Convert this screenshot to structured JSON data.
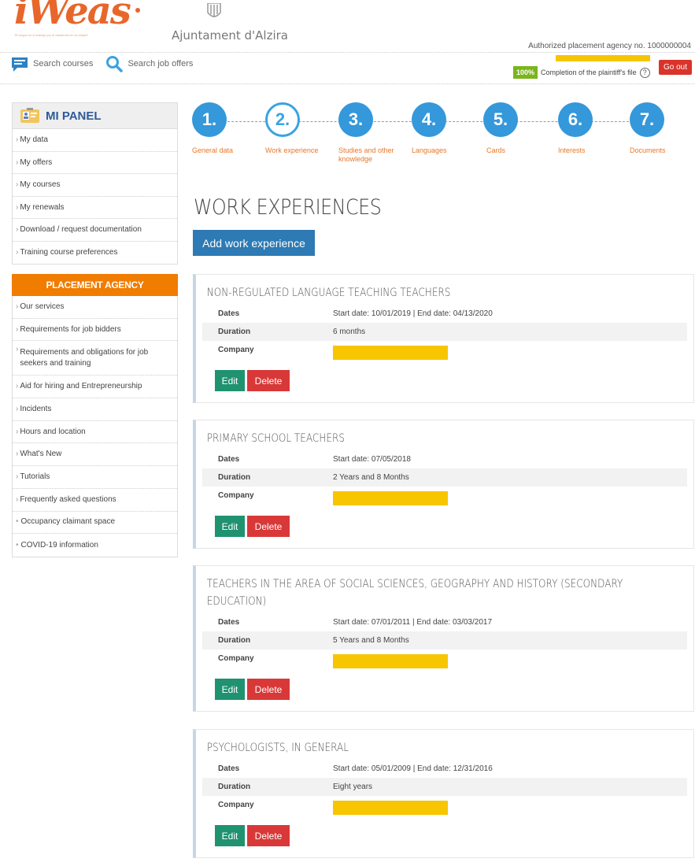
{
  "header": {
    "logo": "iWeas",
    "tagline": "\"El seguir en el trabajo por el desarrollo en la ciudad\"",
    "city": "Ajuntament d'Alzira",
    "agency_no": "Authorized placement agency no. 1000000004",
    "search_courses": "Search courses",
    "search_jobs": "Search job offers",
    "completion_pct": "100%",
    "completion_text": "Completion of the plaintiff's file",
    "help": "?",
    "go_out": "Go out"
  },
  "sidebar": {
    "panel_title": "MI PANEL",
    "panel_items": [
      "My data",
      "My offers",
      "My courses",
      "My renewals",
      "Download / request documentation",
      "Training course preferences"
    ],
    "agency_title": "PLACEMENT AGENCY",
    "agency_items": [
      "Our services",
      "Requirements for job bidders",
      "Requirements and obligations for job seekers and training",
      "Aid for hiring and Entrepreneurship",
      "Incidents",
      "Hours and location",
      "What's New",
      "Tutorials",
      "Frequently asked questions",
      "Occupancy claimant space",
      "COVID-19 information"
    ]
  },
  "steps": [
    {
      "num": "1.",
      "label": "General data"
    },
    {
      "num": "2.",
      "label": "Work experience"
    },
    {
      "num": "3.",
      "label": "Studies and other knowledge"
    },
    {
      "num": "4.",
      "label": "Languages"
    },
    {
      "num": "5.",
      "label": "Cards"
    },
    {
      "num": "6.",
      "label": "Interests"
    },
    {
      "num": "7.",
      "label": "Documents"
    }
  ],
  "main": {
    "title": "WORK EXPERIENCES",
    "add_button": "Add work experience",
    "labels": {
      "dates": "Dates",
      "duration": "Duration",
      "company": "Company"
    },
    "edit": "Edit",
    "delete": "Delete",
    "experiences": [
      {
        "title": "NON-REGULATED LANGUAGE TEACHING TEACHERS",
        "dates": "Start date: 10/01/2019 | End date: 04/13/2020",
        "duration": "6 months"
      },
      {
        "title": "PRIMARY SCHOOL TEACHERS",
        "dates": "Start date: 07/05/2018",
        "duration": "2 Years and 8 Months"
      },
      {
        "title": "TEACHERS IN THE AREA OF SOCIAL SCIENCES, GEOGRAPHY AND HISTORY (SECONDARY EDUCATION)",
        "dates": "Start date: 07/01/2011 | End date: 03/03/2017",
        "duration": "5 Years and 8 Months"
      },
      {
        "title": "PSYCHOLOGISTS, IN GENERAL",
        "dates": "Start date: 05/01/2009 | End date: 12/31/2016",
        "duration": "Eight years"
      }
    ]
  },
  "colors": {
    "accent": "#3498db",
    "orange": "#f07c00",
    "edit": "#1f9270",
    "delete": "#d93838",
    "redaction": "#f7c600"
  }
}
